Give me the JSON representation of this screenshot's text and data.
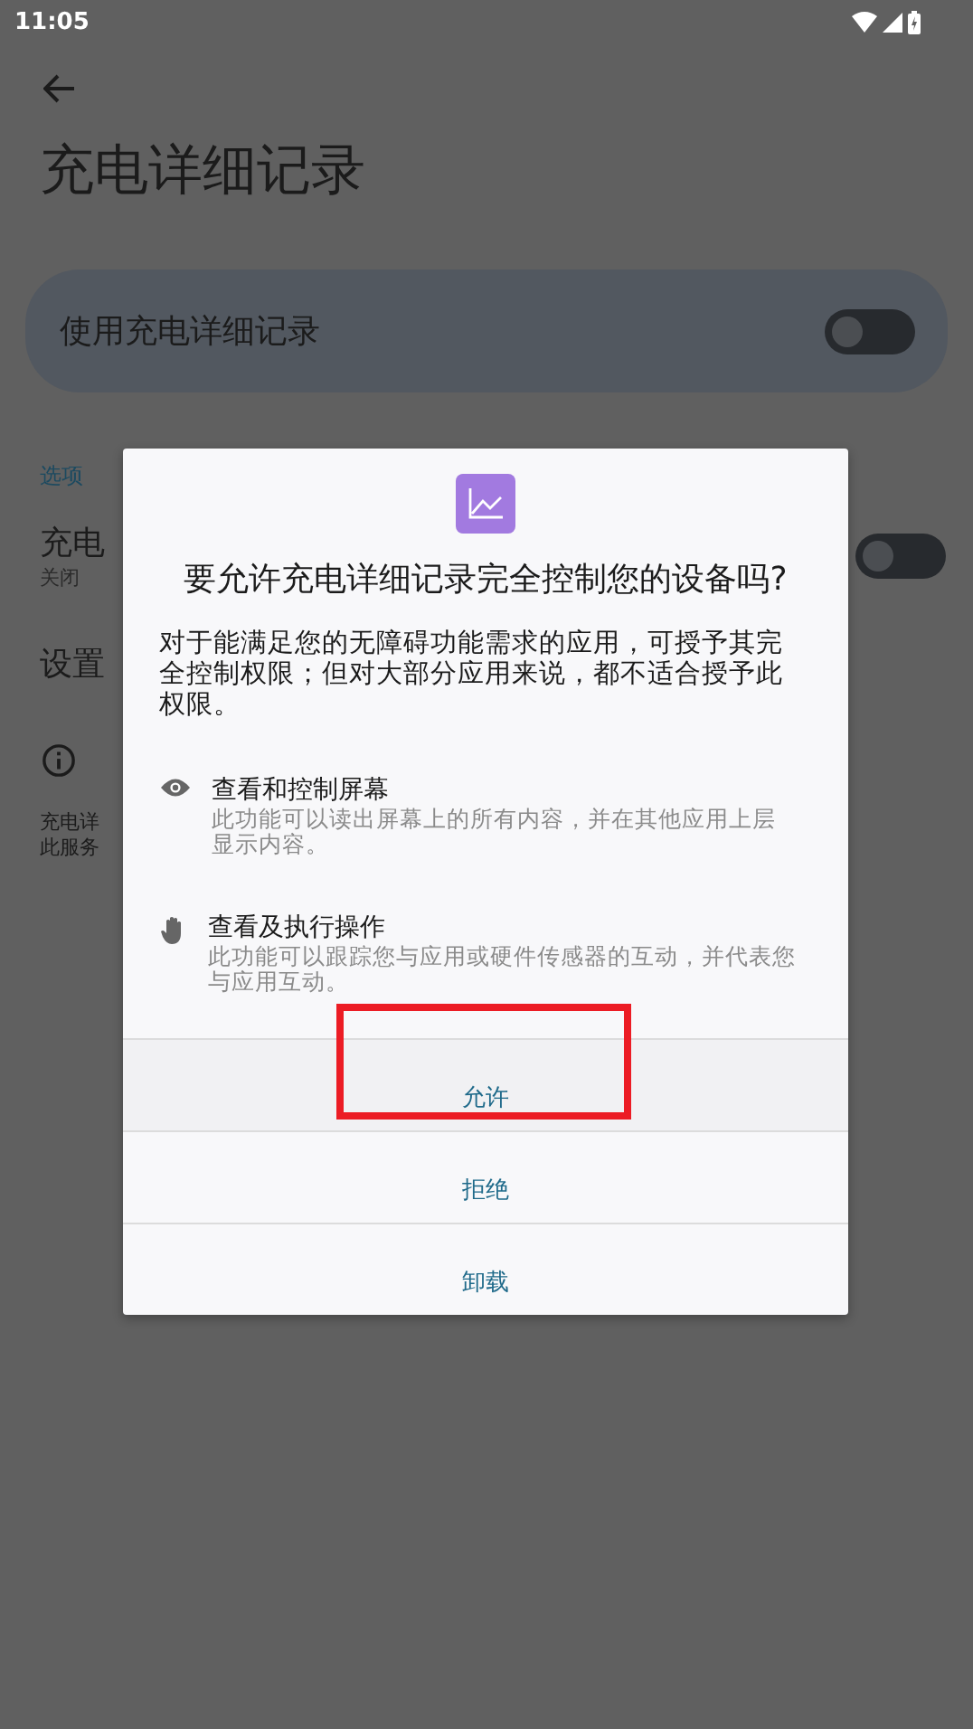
{
  "status_bar": {
    "time": "11:05"
  },
  "page": {
    "title": "充电详细记录",
    "main_switch": {
      "label": "使用充电详细记录",
      "on": false
    },
    "section_header": "选项",
    "items": [
      {
        "kind": "switch",
        "title": "充电",
        "subtitle": "关闭",
        "on": false
      },
      {
        "kind": "text",
        "title": "设置"
      }
    ],
    "footer_lines": [
      "充电详",
      "此服务"
    ]
  },
  "dialog": {
    "title": "要允许充电详细记录完全控制您的设备吗?",
    "message": "对于能满足您的无障碍功能需求的应用，可授予其完全控制权限；但对大部分应用来说，都不适合授予此权限。",
    "permissions": [
      {
        "kind": "view",
        "title": "查看和控制屏幕",
        "description": "此功能可以读出屏幕上的所有内容，并在其他应用上层显示内容。"
      },
      {
        "kind": "action",
        "title": "查看及执行操作",
        "description": "此功能可以跟踪您与应用或硬件传感器的互动，并代表您与应用互动。"
      }
    ],
    "buttons": [
      {
        "label": "允许",
        "highlighted": true
      },
      {
        "label": "拒绝",
        "highlighted": false
      },
      {
        "label": "卸载",
        "highlighted": false
      }
    ]
  }
}
